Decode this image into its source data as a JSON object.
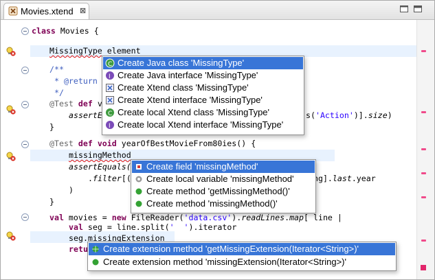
{
  "tab": {
    "title": "Movies.xtend",
    "close": "⊠"
  },
  "code": {
    "l1": {
      "kw": "class",
      "rest": " Movies {"
    },
    "l2": {
      "type": "MissingType",
      "rest": " element"
    },
    "l3": "/**",
    "l4": " * @return",
    "l5": " */",
    "l6": {
      "ann": "@Test",
      "kw": "def",
      "rest": " v"
    },
    "l7": {
      "text": "assertE",
      "tail_pre": "s(",
      "tail_str": "'Action'",
      "tail_post": ")].",
      "tail_it": "size",
      "tail_end": ")"
    },
    "l8": "}",
    "l9": {
      "ann": "@Test",
      "kw1": "def",
      "kw2": "void",
      "rest": " yearOfBestMovieFrom80ies() {"
    },
    "l10": "missingMethod",
    "l11": "assertEquals(",
    "l12": {
      "pre": ".",
      "it": "filter",
      "rest": "[(",
      "tail": "ing].",
      "tail_it": "last",
      "tail_end": ".year"
    },
    "l13": ")",
    "l14": "}",
    "l15": {
      "kw1": "val",
      "rest1": " movies = ",
      "kw2": "new",
      "rest2": " FileReader(",
      "str": "'data.csv'",
      "rest3": ").",
      "it1": "readLines",
      "rest4": ".",
      "it2": "map",
      "rest5": "[ line |"
    },
    "l16": {
      "kw": "val",
      "rest": " seg = line.split(",
      "str": "'  '",
      "rest2": ").iterator"
    },
    "l17": {
      "pre": "seg.",
      "squig": "missingExtension"
    },
    "l18": "retu"
  },
  "popup_type": {
    "items": [
      {
        "label": "Create Java class 'MissingType'",
        "icon": "java-class-icon",
        "selected": true
      },
      {
        "label": "Create Java interface 'MissingType'",
        "icon": "java-interface-icon"
      },
      {
        "label": "Create Xtend class 'MissingType'",
        "icon": "xtend-class-icon"
      },
      {
        "label": "Create Xtend interface 'MissingType'",
        "icon": "xtend-interface-icon"
      },
      {
        "label": "Create local Xtend class 'MissingType'",
        "icon": "local-class-icon"
      },
      {
        "label": "Create local Xtend interface 'MissingType'",
        "icon": "local-interface-icon"
      }
    ]
  },
  "popup_method": {
    "items": [
      {
        "label": "Create field 'missingMethod'",
        "icon": "field-icon",
        "selected": true
      },
      {
        "label": "Create local variable 'missingMethod'",
        "icon": "local-variable-icon"
      },
      {
        "label": "Create method 'getMissingMethod()'",
        "icon": "method-icon"
      },
      {
        "label": "Create method 'missingMethod()'",
        "icon": "method-icon"
      }
    ]
  },
  "popup_ext": {
    "items": [
      {
        "label": "Create extension method 'getMissingExtension(Iterator<String>)'",
        "icon": "extension-method-icon",
        "selected": true
      },
      {
        "label": "Create extension method 'missingExtension(Iterator<String>)'",
        "icon": "method-icon"
      }
    ]
  },
  "colors": {
    "selection": "#3875d7",
    "error": "#e01010",
    "keyword": "#7f0055",
    "string": "#2a00ff",
    "ruler_mark": "#f04a8a"
  }
}
